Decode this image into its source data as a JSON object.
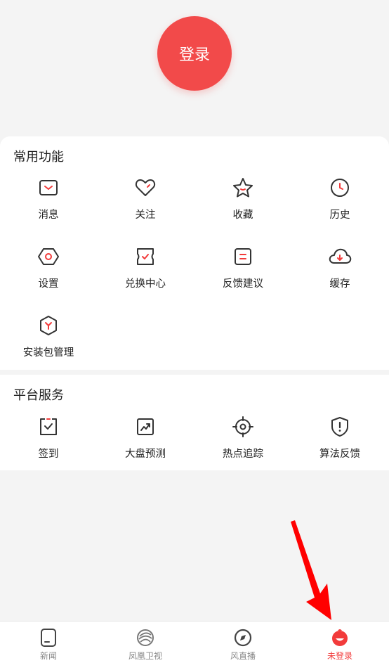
{
  "login": {
    "label": "登录"
  },
  "common": {
    "title": "常用功能",
    "items": [
      {
        "label": "消息",
        "icon": "message-icon"
      },
      {
        "label": "关注",
        "icon": "heart-icon"
      },
      {
        "label": "收藏",
        "icon": "star-icon"
      },
      {
        "label": "历史",
        "icon": "clock-icon"
      },
      {
        "label": "设置",
        "icon": "settings-icon"
      },
      {
        "label": "兑换中心",
        "icon": "ticket-icon"
      },
      {
        "label": "反馈建议",
        "icon": "feedback-icon"
      },
      {
        "label": "缓存",
        "icon": "cloud-download-icon"
      },
      {
        "label": "安装包管理",
        "icon": "package-icon"
      }
    ]
  },
  "platform": {
    "title": "平台服务",
    "items": [
      {
        "label": "签到",
        "icon": "checkin-icon"
      },
      {
        "label": "大盘预测",
        "icon": "trend-chart-icon"
      },
      {
        "label": "热点追踪",
        "icon": "target-icon"
      },
      {
        "label": "算法反馈",
        "icon": "shield-alert-icon"
      }
    ]
  },
  "tabbar": {
    "tabs": [
      {
        "label": "新闻",
        "icon": "news-icon"
      },
      {
        "label": "凤凰卫视",
        "icon": "phoenix-icon"
      },
      {
        "label": "风直播",
        "icon": "compass-icon"
      },
      {
        "label": "未登录",
        "icon": "avatar-icon",
        "active": true
      }
    ]
  },
  "colors": {
    "accent": "#f24a4a",
    "arrow": "#ff0000",
    "icon_stroke": "#333333",
    "icon_accent": "#f23b3b"
  }
}
